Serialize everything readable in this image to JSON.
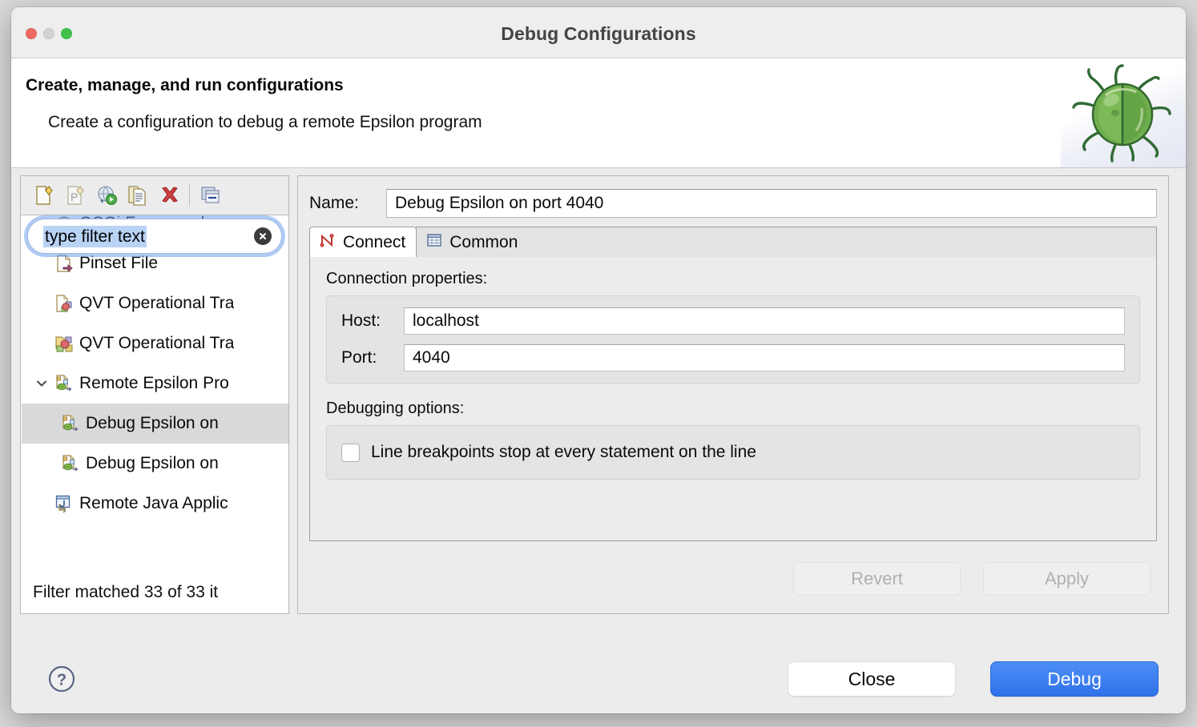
{
  "window": {
    "title": "Debug Configurations",
    "traffic_lights": [
      "close-red",
      "minimize-yellow",
      "zoom-green"
    ]
  },
  "header": {
    "title": "Create, manage, and run configurations",
    "subtitle": "Create a configuration to debug a remote Epsilon program",
    "art_icon": "green-bug-illustration"
  },
  "tree_toolbar": {
    "buttons": [
      {
        "name": "new-launch-configuration",
        "icon": "new-config-icon"
      },
      {
        "name": "new-prototype",
        "icon": "new-prototype-icon"
      },
      {
        "name": "export-launch-configuration",
        "icon": "globe-run-icon"
      },
      {
        "name": "duplicate-configuration",
        "icon": "duplicate-icon"
      },
      {
        "name": "delete-configuration",
        "icon": "delete-x-icon"
      },
      {
        "name": "collapse-all",
        "icon": "collapse-all-icon"
      }
    ]
  },
  "filter": {
    "value": "type filter text",
    "placeholder": "type filter text",
    "selected": true,
    "clear_icon": "clear-circle-icon"
  },
  "tree": {
    "rows": [
      {
        "label": "OSGi Framework",
        "icon": "osgi-framework-icon",
        "indent": 0,
        "twisty": "",
        "selected": false
      },
      {
        "label": "Pinset File",
        "icon": "pinset-file-icon",
        "indent": 0,
        "twisty": "",
        "selected": false
      },
      {
        "label": "QVT Operational Tra",
        "icon": "qvt-file-icon",
        "indent": 0,
        "twisty": "",
        "selected": false
      },
      {
        "label": "QVT Operational Tra",
        "icon": "qvt-folder-icon",
        "indent": 0,
        "twisty": "",
        "selected": false
      },
      {
        "label": "Remote Epsilon Pro",
        "icon": "remote-epsilon-icon",
        "indent": 0,
        "twisty": "expanded",
        "selected": false
      },
      {
        "label": "Debug Epsilon on",
        "icon": "remote-epsilon-icon",
        "indent": 1,
        "twisty": "",
        "selected": true
      },
      {
        "label": "Debug Epsilon on",
        "icon": "remote-epsilon-icon",
        "indent": 1,
        "twisty": "",
        "selected": false
      },
      {
        "label": "Remote Java Applic",
        "icon": "remote-java-icon",
        "indent": 0,
        "twisty": "",
        "selected": false
      }
    ],
    "status": "Filter matched 33 of 33 it"
  },
  "config": {
    "name_label": "Name:",
    "name_value": "Debug Epsilon on port 4040",
    "tabs": [
      {
        "label": "Connect",
        "icon": "connect-graph-icon",
        "active": true
      },
      {
        "label": "Common",
        "icon": "common-table-icon",
        "active": false
      }
    ],
    "connection_group_label": "Connection properties:",
    "fields": [
      {
        "label": "Host:",
        "value": "localhost"
      },
      {
        "label": "Port:",
        "value": "4040"
      }
    ],
    "debugging_group_label": "Debugging options:",
    "checkbox": {
      "label": "Line breakpoints stop at every statement on the line",
      "checked": false
    },
    "revert_label": "Revert",
    "apply_label": "Apply",
    "revert_enabled": false,
    "apply_enabled": false
  },
  "footer": {
    "help_icon": "help-question-icon",
    "close_label": "Close",
    "debug_label": "Debug",
    "debug_accent_color": "#3b7dee"
  }
}
